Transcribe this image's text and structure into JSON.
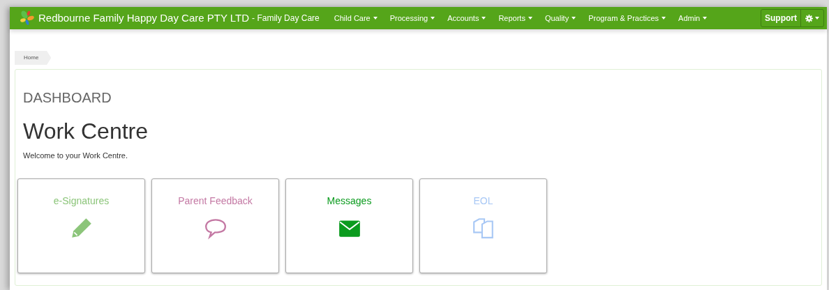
{
  "brand": {
    "name": "Redbourne Family Happy Day Care PTY LTD",
    "suffix": "- Family Day Care"
  },
  "nav": [
    {
      "label": "Child Care"
    },
    {
      "label": "Processing"
    },
    {
      "label": "Accounts"
    },
    {
      "label": "Reports"
    },
    {
      "label": "Quality"
    },
    {
      "label": "Program & Practices"
    },
    {
      "label": "Admin"
    }
  ],
  "support_button": "Support",
  "breadcrumb": [
    "Home"
  ],
  "page": {
    "section": "DASHBOARD",
    "title": "Work Centre",
    "welcome": "Welcome to your Work Centre."
  },
  "tiles": [
    {
      "label": "e-Signatures",
      "kind": "pencil",
      "color": "#8cc57a"
    },
    {
      "label": "Parent Feedback",
      "kind": "speech",
      "color": "#c479a4"
    },
    {
      "label": "Messages",
      "kind": "envelope",
      "color": "#0b9b1e"
    },
    {
      "label": "EOL",
      "kind": "copy",
      "color": "#a8c8f5"
    }
  ]
}
